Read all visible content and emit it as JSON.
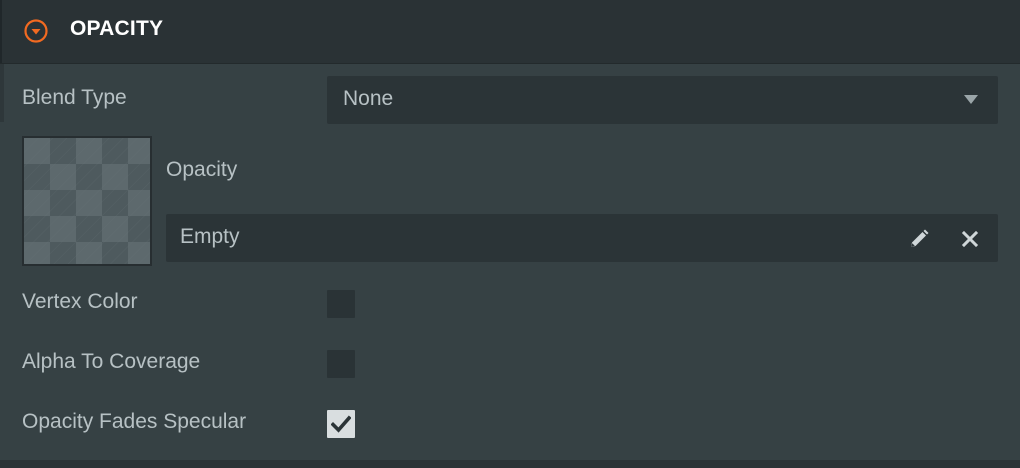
{
  "section": {
    "title": "OPACITY",
    "collapse_icon": "chevron-circle-down-icon",
    "accent_color": "#f26a21"
  },
  "blend_type": {
    "label": "Blend Type",
    "value": "None",
    "caret_icon": "caret-down-icon"
  },
  "opacity_map": {
    "label": "Opacity",
    "value": "Empty",
    "thumbnail": "checkerboard-preview",
    "edit_icon": "pencil-icon",
    "clear_icon": "close-icon"
  },
  "options": [
    {
      "label": "Vertex Color",
      "checked": false
    },
    {
      "label": "Alpha To Coverage",
      "checked": false
    },
    {
      "label": "Opacity Fades Specular",
      "checked": true
    }
  ]
}
